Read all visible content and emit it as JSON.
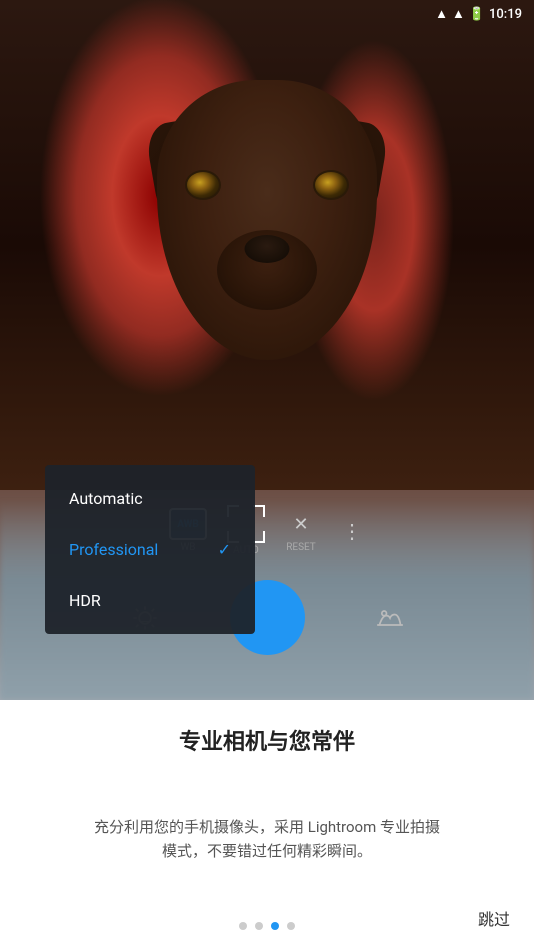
{
  "statusBar": {
    "time": "10:19",
    "batteryIcon": "🔋",
    "wifiIcon": "▲"
  },
  "cameraUI": {
    "wbLabel": "WB",
    "wbSubLabel": "AWB",
    "autoLabel": "AUTO",
    "resetLabel": "RESET",
    "moreDotsIcon": "⋮"
  },
  "dropdown": {
    "items": [
      {
        "label": "Automatic",
        "active": false
      },
      {
        "label": "Professional",
        "active": true
      },
      {
        "label": "HDR",
        "active": false
      }
    ]
  },
  "bottomPanel": {
    "title": "专业相机与您常伴",
    "description": "充分利用您的手机摄像头，采用 Lightroom 专业拍摄模式，不要错过任何精彩瞬间。",
    "dots": [
      {
        "active": false
      },
      {
        "active": false
      },
      {
        "active": true
      },
      {
        "active": false
      }
    ],
    "skipLabel": "跳过"
  },
  "icons": {
    "focusFrame": "[ ]",
    "closeX": "✕",
    "verticalDots": "⋮"
  }
}
